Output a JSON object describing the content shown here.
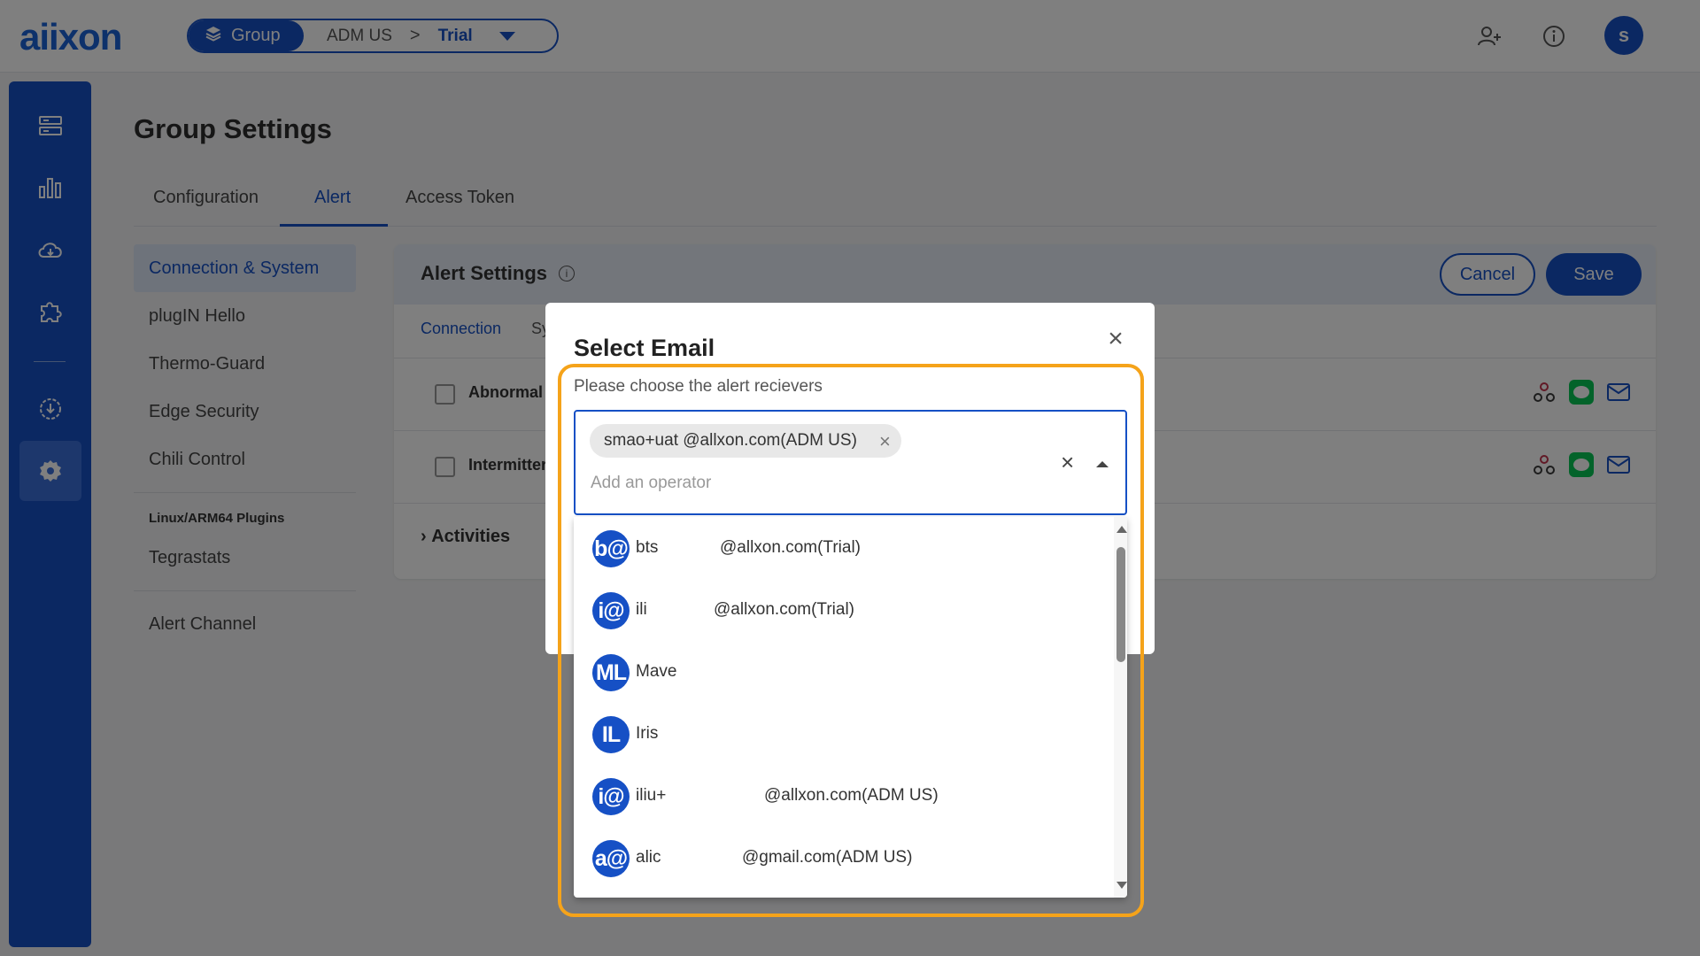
{
  "header": {
    "logo": "aiixon",
    "breadcrumb": {
      "group_label": "Group",
      "org": "ADM US",
      "separator": ">",
      "current": "Trial"
    },
    "avatar_initial": "s"
  },
  "page": {
    "title": "Group Settings",
    "tabs": [
      {
        "label": "Configuration"
      },
      {
        "label": "Alert"
      },
      {
        "label": "Access Token"
      }
    ]
  },
  "subnav": {
    "items": [
      "Connection & System",
      "plugIN Hello",
      "Thermo-Guard",
      "Edge Security",
      "Chili Control"
    ],
    "section_heading": "Linux/ARM64 Plugins",
    "section_items": [
      "Tegrastats"
    ],
    "footer_item": "Alert Channel"
  },
  "panel": {
    "title": "Alert Settings",
    "info": "i",
    "cancel": "Cancel",
    "save": "Save",
    "tab1": "Connection",
    "tab2": "Sy",
    "rows": [
      "Abnormal",
      "Intermitter"
    ],
    "activities": "Activities"
  },
  "dialog": {
    "title": "Select Email",
    "close": "×",
    "subtitle": "Please choose the alert recievers",
    "chip": "smao+uat @allxon.com(ADM US)",
    "chip_remove": "×",
    "placeholder": "Add an operator",
    "clear": "×",
    "options": [
      {
        "avatar": "b@",
        "name": "bts",
        "email": "@allxon.com(Trial)"
      },
      {
        "avatar": "i@",
        "name": "ili",
        "email": "@allxon.com(Trial)"
      },
      {
        "avatar": "ML",
        "name": "Mave",
        "email": ""
      },
      {
        "avatar": "IL",
        "name": "Iris",
        "email": ""
      },
      {
        "avatar": "i@",
        "name": "iliu+",
        "email": "@allxon.com(ADM US)"
      },
      {
        "avatar": "a@",
        "name": "alic",
        "email": "@gmail.com(ADM US)"
      }
    ]
  },
  "colors": {
    "primary": "#1650c5",
    "highlight": "#f5a31a"
  }
}
